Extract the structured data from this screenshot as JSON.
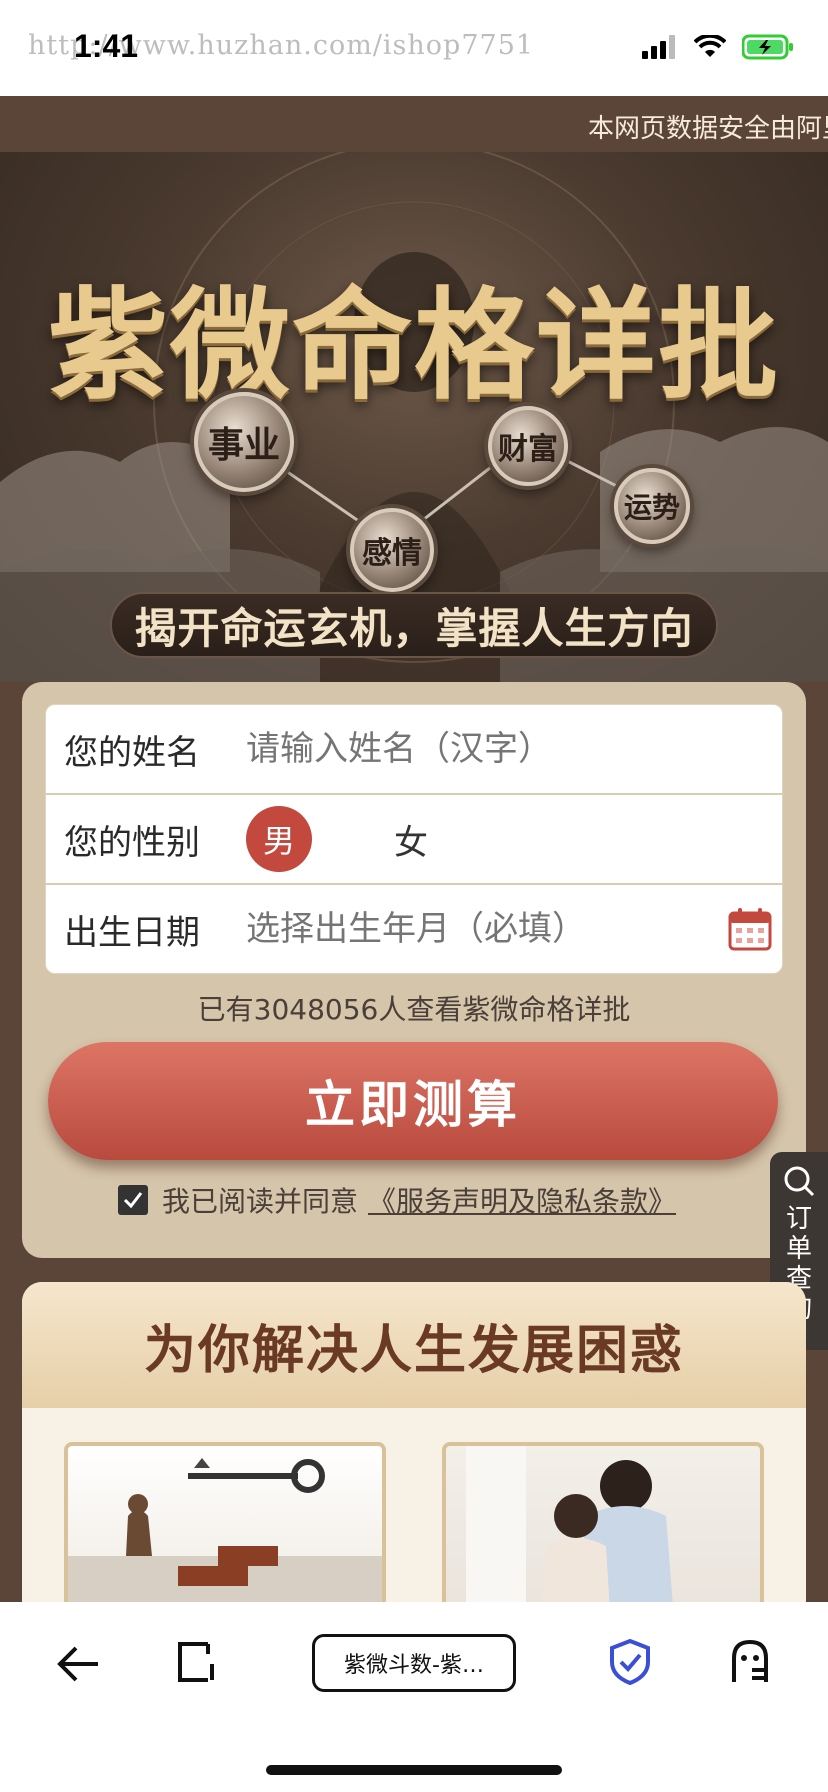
{
  "status_bar": {
    "time": "1:41",
    "watermark_url": "http://www.huzhan.com/ishop7751"
  },
  "marquee": {
    "text": "本网页数据安全由阿里"
  },
  "hero": {
    "title": "紫微命格详批",
    "nodes": [
      "事业",
      "财富",
      "运势",
      "感情"
    ],
    "subtitle": "揭开命运玄机，掌握人生方向"
  },
  "form": {
    "name_label": "您的姓名",
    "name_placeholder": "请输入姓名（汉字）",
    "gender_label": "您的性别",
    "gender_male": "男",
    "gender_female": "女",
    "birth_label": "出生日期",
    "birth_placeholder": "选择出生年月（必填）",
    "count_text": "已有3048056人查看紫微命格详批",
    "submit_label": "立即测算",
    "agree_text": "我已阅读并同意",
    "agree_link": "《服务声明及隐私条款》"
  },
  "side_float": {
    "label": "订单查询"
  },
  "section2": {
    "title": "为你解决人生发展困惑"
  },
  "browser": {
    "tab_title": "紫微斗数-紫…"
  },
  "colors": {
    "brand_brown": "#5b4538",
    "accent_red": "#c3483d",
    "gold": "#e8c98e",
    "card_beige": "#d5c5aa"
  }
}
